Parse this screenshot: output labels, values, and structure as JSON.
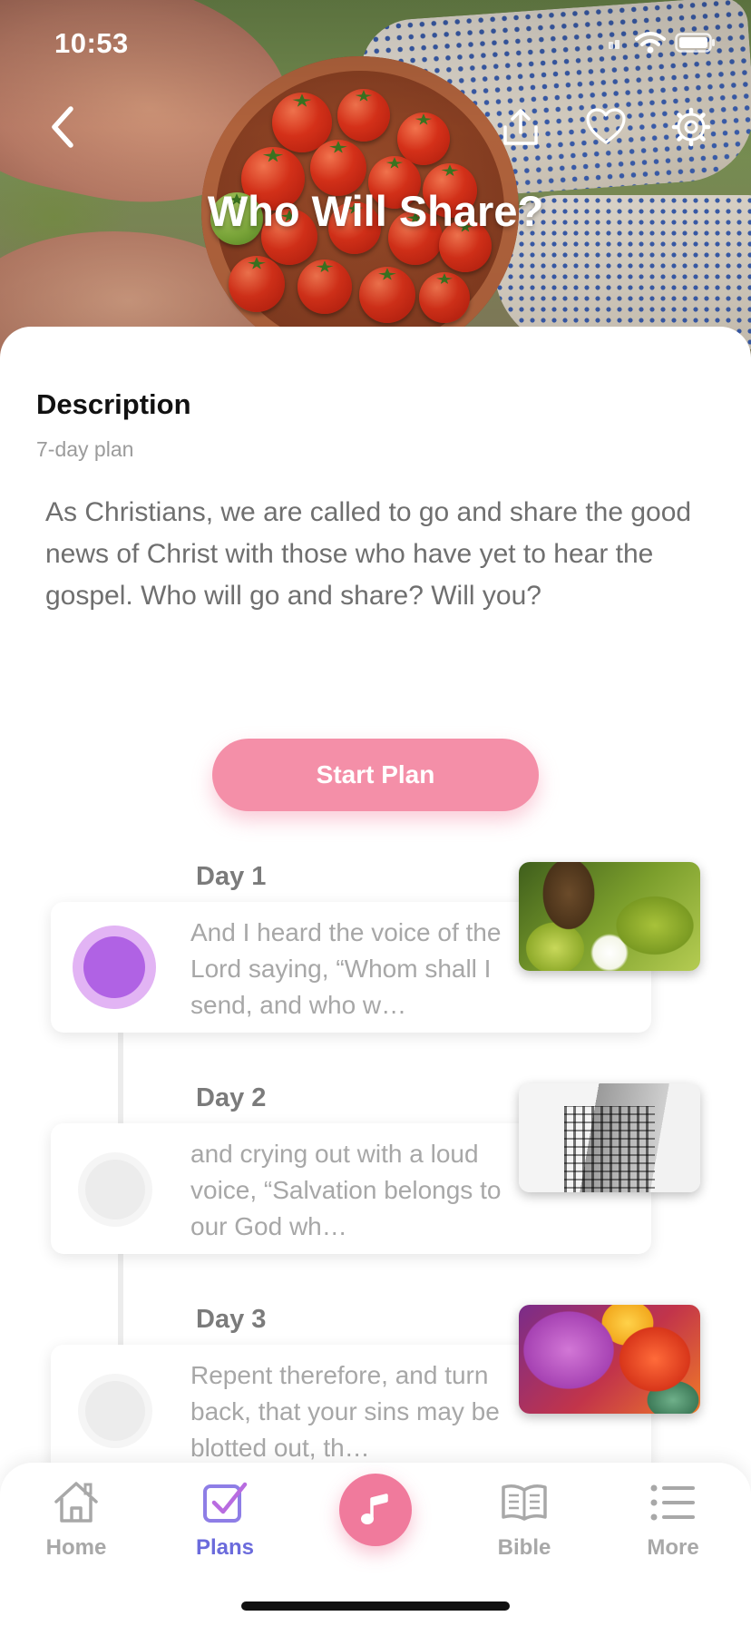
{
  "status_bar": {
    "time": "10:53"
  },
  "header": {
    "title": "Who Will Share?"
  },
  "description": {
    "heading": "Description",
    "subtitle": "7-day plan",
    "body": "As Christians, we are called to go and share the good news of Christ with those who have yet to hear the gospel. Who will go and share? Will you?"
  },
  "start_button": {
    "label": "Start Plan"
  },
  "days": [
    {
      "label": "Day 1",
      "text": "And I heard the voice of the Lord saying, “Whom shall I send, and who w…",
      "state": "current"
    },
    {
      "label": "Day 2",
      "text": "and crying out with a loud voice, “Salvation belongs to our God wh…",
      "state": "upcoming"
    },
    {
      "label": "Day 3",
      "text": "Repent therefore, and turn back, that your sins may be blotted out, th…",
      "state": "upcoming"
    }
  ],
  "tabbar": {
    "items": [
      {
        "label": "Home",
        "icon": "home-icon"
      },
      {
        "label": "Plans",
        "icon": "checkbox-icon",
        "selected": true
      },
      {
        "label": "",
        "icon": "music-note-icon"
      },
      {
        "label": "Bible",
        "icon": "book-icon"
      },
      {
        "label": "More",
        "icon": "list-icon"
      }
    ]
  },
  "colors": {
    "accent_pink": "#f48fa8",
    "selected_tab": "#6b6bdc",
    "progress_purple": "#b062e4"
  }
}
